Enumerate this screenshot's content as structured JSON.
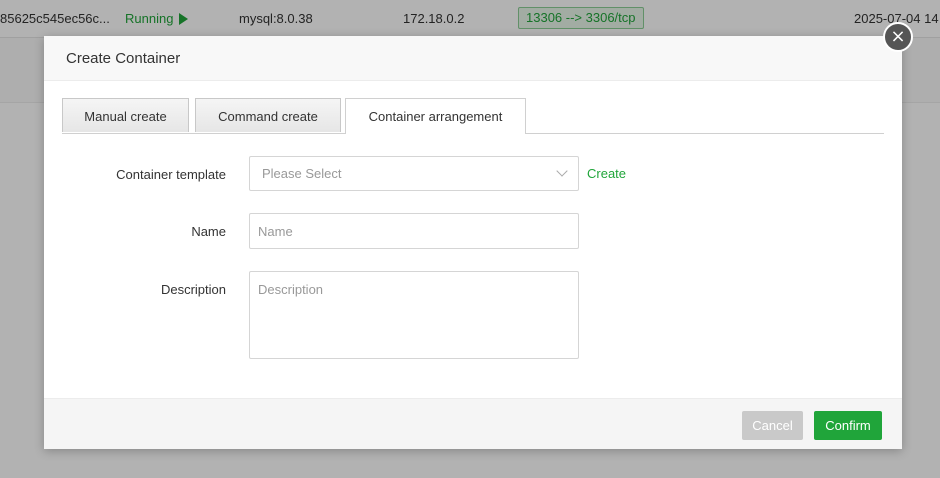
{
  "background": {
    "row": {
      "container_id": "85625c545ec56c...",
      "status": "Running",
      "image": "mysql:8.0.38",
      "ip": "172.18.0.2",
      "port": "13306 --> 3306/tcp",
      "created": "2025-07-04 14"
    }
  },
  "modal": {
    "title": "Create Container",
    "close_icon": "×",
    "tabs": [
      {
        "label": "Manual create",
        "active": false
      },
      {
        "label": "Command create",
        "active": false
      },
      {
        "label": "Container arrangement",
        "active": true
      }
    ],
    "form": {
      "template_label": "Container template",
      "template_placeholder": "Please Select",
      "create_link": "Create",
      "name_label": "Name",
      "name_placeholder": "Name",
      "name_value": "",
      "description_label": "Description",
      "description_placeholder": "Description",
      "description_value": ""
    },
    "footer": {
      "cancel_label": "Cancel",
      "confirm_label": "Confirm"
    }
  },
  "colors": {
    "accent_green": "#20a53a",
    "cancel_gray": "#c9c9c9",
    "overlay": "rgba(0,0,0,0.30)"
  }
}
